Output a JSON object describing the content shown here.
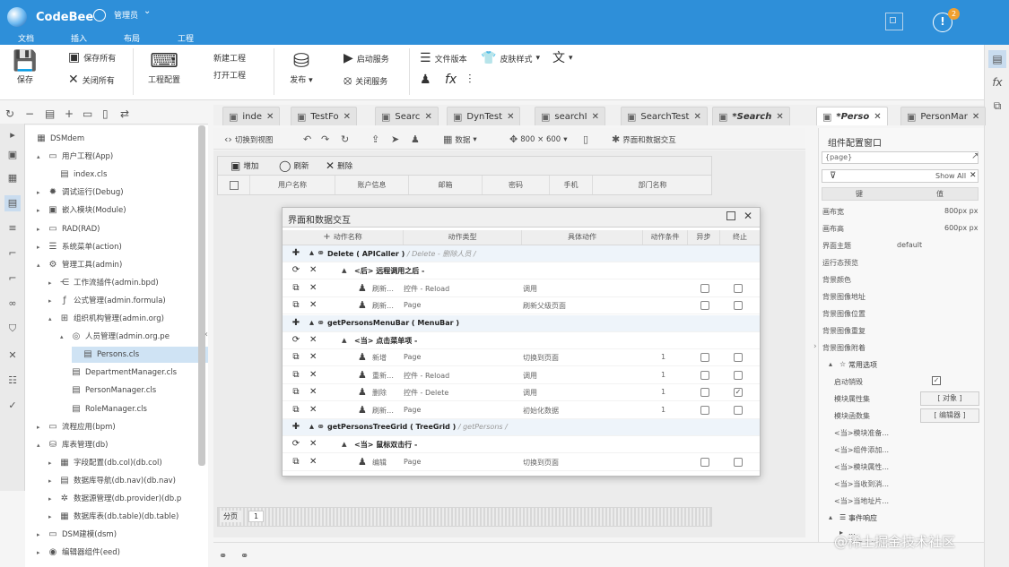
{
  "app": {
    "name": "CodeBee",
    "user": "管理员",
    "menus": [
      "文档",
      "插入",
      "布局",
      "工程"
    ],
    "badge": "2",
    "accent": "#2e8fd9"
  },
  "ribbon": {
    "save": "保存",
    "save_all": "保存所有",
    "close_all": "关闭所有",
    "project_config": "工程配置",
    "new_project": "新建工程",
    "open_project": "打开工程",
    "publish": "发布",
    "start_service": "启动服务",
    "stop_service": "关闭服务",
    "file_version": "文件版本",
    "skin_style": "皮肤样式"
  },
  "tree": [
    {
      "label": "DSMdem",
      "level": 0,
      "icon": "grid-icon",
      "arrow": ""
    },
    {
      "label": "用户工程(App)",
      "level": 1,
      "icon": "folder-icon",
      "arrow": "▴"
    },
    {
      "label": "index.cls",
      "level": 2,
      "icon": "file-icon",
      "arrow": ""
    },
    {
      "label": "调试运行(Debug)",
      "level": 1,
      "icon": "bug-icon",
      "arrow": "▸"
    },
    {
      "label": "嵌入模块(Module)",
      "level": 1,
      "icon": "module-icon",
      "arrow": "▸"
    },
    {
      "label": "RAD(RAD)",
      "level": 1,
      "icon": "folder-icon",
      "arrow": "▸"
    },
    {
      "label": "系统菜单(action)",
      "level": 1,
      "icon": "menu-icon",
      "arrow": "▸"
    },
    {
      "label": "管理工具(admin)",
      "level": 1,
      "icon": "gear-icon",
      "arrow": "▴"
    },
    {
      "label": "工作流插件(admin.bpd)",
      "level": 2,
      "icon": "flow-icon",
      "arrow": "▸"
    },
    {
      "label": "公式管理(admin.formula)",
      "level": 2,
      "icon": "formula-icon",
      "arrow": "▸"
    },
    {
      "label": "组织机构管理(admin.org)",
      "level": 2,
      "icon": "org-icon",
      "arrow": "▴"
    },
    {
      "label": "人员管理(admin.org.pe",
      "level": 3,
      "icon": "person-icon",
      "arrow": "▴"
    },
    {
      "label": "Persons.cls",
      "level": 4,
      "icon": "file-icon",
      "arrow": "",
      "selected": true
    },
    {
      "label": "DepartmentManager.cls",
      "level": 3,
      "icon": "file-icon",
      "arrow": ""
    },
    {
      "label": "PersonManager.cls",
      "level": 3,
      "icon": "file-icon",
      "arrow": ""
    },
    {
      "label": "RoleManager.cls",
      "level": 3,
      "icon": "file-icon",
      "arrow": ""
    },
    {
      "label": "流程应用(bpm)",
      "level": 1,
      "icon": "folder-icon",
      "arrow": "▸"
    },
    {
      "label": "库表管理(db)",
      "level": 1,
      "icon": "db-icon",
      "arrow": "▴"
    },
    {
      "label": "字段配置(db.col)(db.col)",
      "level": 2,
      "icon": "table-icon",
      "arrow": "▸"
    },
    {
      "label": "数据库导航(db.nav)(db.nav)",
      "level": 2,
      "icon": "nav-icon",
      "arrow": "▸"
    },
    {
      "label": "数据源管理(db.provider)(db.p",
      "level": 2,
      "icon": "provider-icon",
      "arrow": "▸"
    },
    {
      "label": "数据库表(db.table)(db.table)",
      "level": 2,
      "icon": "table-icon",
      "arrow": "▸"
    },
    {
      "label": "DSM建模(dsm)",
      "level": 1,
      "icon": "folder-icon",
      "arrow": "▸"
    },
    {
      "label": "编辑器组件(eed)",
      "level": 1,
      "icon": "component-icon",
      "arrow": "▸"
    }
  ],
  "tabs": [
    {
      "label": "inde",
      "italic": false,
      "active": false
    },
    {
      "label": "TestFo",
      "italic": false,
      "active": false
    },
    {
      "label": "Searc",
      "italic": false,
      "active": false
    },
    {
      "label": "DynTest",
      "italic": false,
      "active": false
    },
    {
      "label": "searchI",
      "italic": false,
      "active": false
    },
    {
      "label": "SearchTest",
      "italic": false,
      "active": false
    },
    {
      "label": "*Search",
      "italic": true,
      "active": false
    },
    {
      "label": "*Perso",
      "italic": true,
      "active": true
    },
    {
      "label": "PersonMar",
      "italic": false,
      "active": false
    }
  ],
  "canvas_toolbar": {
    "switch_view": "切换到视图",
    "data": "数据",
    "size": "800 × 600",
    "interaction": "界面和数据交互"
  },
  "grid": {
    "add": "增加",
    "refresh": "刷新",
    "delete": "删除",
    "columns": [
      "用户名称",
      "账户信息",
      "邮箱",
      "密码",
      "手机",
      "部门名称"
    ],
    "pager_label": "分页",
    "page": "1"
  },
  "dialog": {
    "title": "界面和数据交互",
    "headers": [
      "动作名称",
      "动作类型",
      "具体动作",
      "动作条件",
      "异步",
      "终止"
    ],
    "rows": [
      {
        "kind": "group",
        "c0": "✚",
        "c1": "▴",
        "title": "Delete ( APICaller )",
        "sub": " / Delete - 删除人员 /"
      },
      {
        "kind": "event",
        "c0": "⟳",
        "c1": "✕",
        "title": "<后> 远程调用之后 -"
      },
      {
        "kind": "action",
        "c0": "⧉",
        "c1": "✕",
        "name": "刷新…",
        "type": "控件 - Reload",
        "detail": "调用",
        "cond": "",
        "async": false,
        "stop": false
      },
      {
        "kind": "action",
        "c0": "⧉",
        "c1": "✕",
        "name": "刷新…",
        "type": "Page",
        "detail": "刷新父级页面",
        "cond": "",
        "async": false,
        "stop": false
      },
      {
        "kind": "group",
        "c0": "✚",
        "c1": "▴",
        "title": "getPersonsMenuBar ( MenuBar )",
        "sub": ""
      },
      {
        "kind": "event",
        "c0": "⟳",
        "c1": "✕",
        "title": "<当> 点击菜单项 -"
      },
      {
        "kind": "action",
        "c0": "⧉",
        "c1": "✕",
        "name": "新增",
        "type": "Page",
        "detail": "切换到页面",
        "cond": "1",
        "async": false,
        "stop": false
      },
      {
        "kind": "action",
        "c0": "⧉",
        "c1": "✕",
        "name": "重新…",
        "type": "控件 - Reload",
        "detail": "调用",
        "cond": "1",
        "async": false,
        "stop": false
      },
      {
        "kind": "action",
        "c0": "⧉",
        "c1": "✕",
        "name": "删除",
        "type": "控件 - Delete",
        "detail": "调用",
        "cond": "1",
        "async": false,
        "stop": true
      },
      {
        "kind": "action",
        "c0": "⧉",
        "c1": "✕",
        "name": "刷新…",
        "type": "Page",
        "detail": "初始化数据",
        "cond": "1",
        "async": false,
        "stop": false
      },
      {
        "kind": "group",
        "c0": "✚",
        "c1": "▴",
        "title": "getPersonsTreeGrid ( TreeGrid )",
        "sub": " / getPersons /"
      },
      {
        "kind": "event",
        "c0": "⟳",
        "c1": "✕",
        "title": "<当> 鼠标双击行 -"
      },
      {
        "kind": "action",
        "c0": "⧉",
        "c1": "✕",
        "name": "编辑",
        "type": "Page",
        "detail": "切换到页面",
        "cond": "",
        "async": false,
        "stop": false
      }
    ]
  },
  "props": {
    "title": "组件配置窗口",
    "page_value": "{page}",
    "show_all": "Show All",
    "col_key": "键",
    "col_val": "值",
    "rows": [
      {
        "k": "画布宽",
        "v": "800px px",
        "vx": 137
      },
      {
        "k": "画布高",
        "v": "600px px",
        "vx": 137
      },
      {
        "k": "界面主题",
        "v": "default",
        "vx": 84
      },
      {
        "k": "运行态预览",
        "v": "",
        "vx": 0
      },
      {
        "k": "背景颜色",
        "v": "",
        "vx": 0
      },
      {
        "k": "背景图像地址",
        "v": "",
        "vx": 0
      },
      {
        "k": "背景图像位置",
        "v": "",
        "vx": 0
      },
      {
        "k": "背景图像重复",
        "v": "",
        "vx": 0
      },
      {
        "k": "背景图像附着",
        "v": "",
        "vx": 0
      }
    ],
    "section": "常用选项",
    "auto_destroy": "启动销毁",
    "module_prop": "模块属性集",
    "module_prop_btn": "[ 对象 ]",
    "module_fn": "模块函数集",
    "module_fn_btn": "[ 编辑器 ]",
    "events": [
      "<当>模块准备...",
      "<当>组件添加...",
      "<当>模块属性...",
      "<当>当收到消...",
      "<当>当地址片..."
    ],
    "section2": "事件响应",
    "events2": [
      "...",
      "可视事件..."
    ]
  },
  "watermark": "@稀土掘金技术社区"
}
